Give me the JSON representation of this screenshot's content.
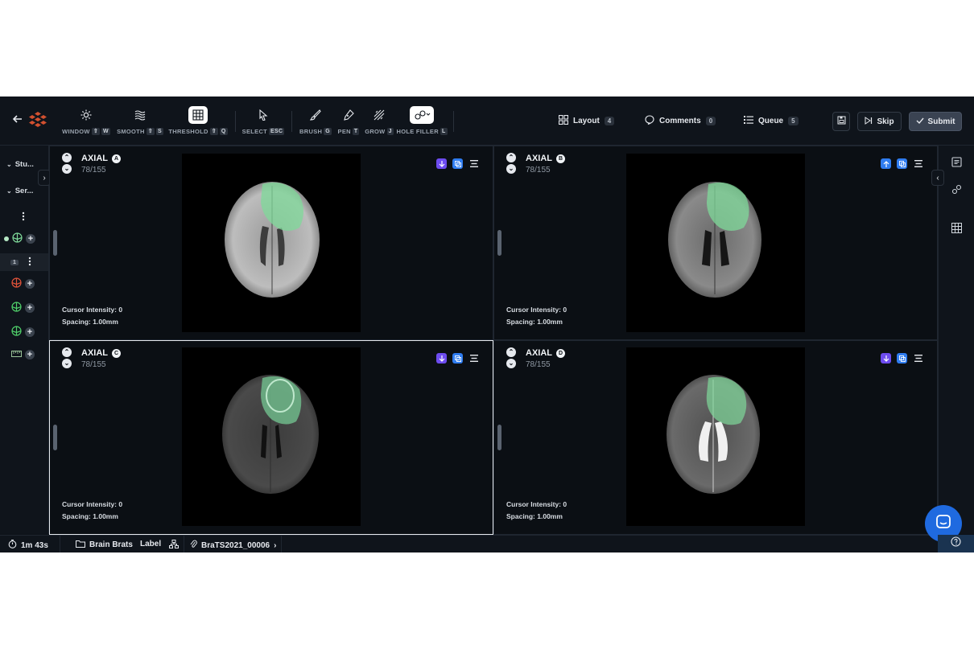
{
  "toolbar": {
    "tools": [
      {
        "label": "WINDOW",
        "keys": [
          "⇧",
          "W"
        ]
      },
      {
        "label": "SMOOTH",
        "keys": [
          "⇧",
          "S"
        ]
      },
      {
        "label": "THRESHOLD",
        "keys": [
          "⇧",
          "Q"
        ]
      },
      {
        "label": "SELECT",
        "keys": [
          "ESC"
        ]
      },
      {
        "label": "BRUSH",
        "keys": [
          "G"
        ]
      },
      {
        "label": "PEN",
        "keys": [
          "T"
        ]
      },
      {
        "label": "GROW",
        "keys": [
          "J"
        ]
      },
      {
        "label": "HOLE FILLER",
        "keys": [
          "L"
        ]
      }
    ],
    "layout": {
      "label": "Layout",
      "count": "4"
    },
    "comments": {
      "label": "Comments",
      "count": "0"
    },
    "queue": {
      "label": "Queue",
      "count": "5"
    },
    "skip_label": "Skip",
    "submit_label": "Submit"
  },
  "sidebar": {
    "study_label": "Stu...",
    "series_label": "Ser...",
    "segment_index": "1"
  },
  "viewports": [
    {
      "title": "AXIAL",
      "letter": "A",
      "slice": "78/155",
      "cursor": "Cursor Intensity: 0",
      "spacing": "Spacing: 1.00mm"
    },
    {
      "title": "AXIAL",
      "letter": "B",
      "slice": "78/155",
      "cursor": "Cursor Intensity: 0",
      "spacing": "Spacing: 1.00mm"
    },
    {
      "title": "AXIAL",
      "letter": "C",
      "slice": "78/155",
      "cursor": "Cursor Intensity: 0",
      "spacing": "Spacing: 1.00mm"
    },
    {
      "title": "AXIAL",
      "letter": "D",
      "slice": "78/155",
      "cursor": "Cursor Intensity: 0",
      "spacing": "Spacing: 1.00mm"
    }
  ],
  "status": {
    "timer": "1m 43s",
    "project": "Brain Brats",
    "label": "Label",
    "dataset": "BraTS2021_00006"
  },
  "colors": {
    "accent_purple": "#6d4cf0",
    "accent_blue": "#2f7cf0",
    "segment_green": "#7fd99a",
    "segment_red": "#e0533a"
  }
}
